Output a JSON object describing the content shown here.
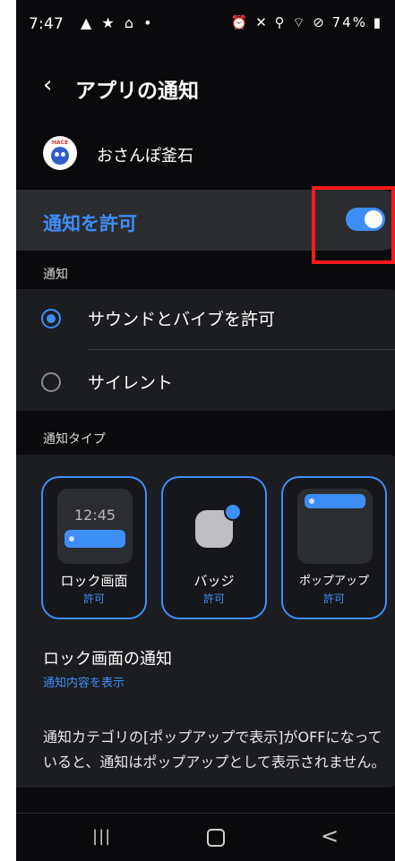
{
  "status_bar": {
    "time": "7:47",
    "left_icons": "▲ ★ ⌂ •",
    "right_icons": "⏰ ✕ ⚲ ⌔ ⊘",
    "battery": "74%"
  },
  "header": {
    "title": "アプリの通知"
  },
  "app": {
    "name": "おさんぽ釜石",
    "icon_caption": "HACE"
  },
  "allow": {
    "label": "通知を許可",
    "enabled": true
  },
  "notifications": {
    "section_label": "通知",
    "options": [
      {
        "label": "サウンドとバイブを許可",
        "selected": true
      },
      {
        "label": "サイレント",
        "selected": false
      }
    ]
  },
  "notification_types": {
    "section_label": "通知タイプ",
    "tiles": [
      {
        "name": "ロック画面",
        "state": "許可",
        "preview_time": "12:45"
      },
      {
        "name": "バッジ",
        "state": "許可"
      },
      {
        "name": "ポップアップ",
        "state": "許可"
      }
    ],
    "lock_screen": {
      "title": "ロック画面の通知",
      "subtitle": "通知内容を表示"
    }
  },
  "info_text": "通知カテゴリの[ポップアップで表示]がOFFになっていると、通知はポップアップとして表示されません。",
  "navbar": {
    "recent": "|||",
    "back": "<"
  },
  "colors": {
    "accent": "#3e8ef7",
    "background": "#0a0a0c",
    "highlight": "#ff1a1a"
  }
}
